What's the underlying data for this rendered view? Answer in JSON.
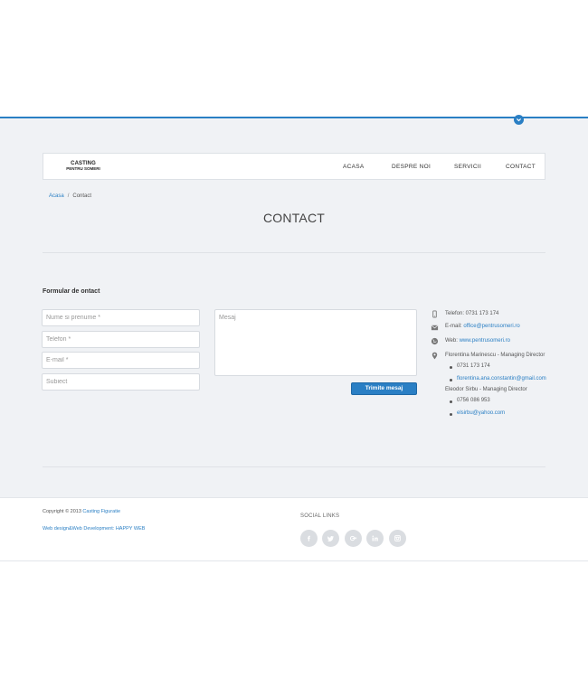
{
  "header": {
    "logo_line1": "CASTING",
    "logo_line2": "PENTRU SOMERI",
    "nav": [
      {
        "label": "ACASA"
      },
      {
        "label": "DESPRE NOI"
      },
      {
        "label": "SERVICII"
      },
      {
        "label": "CONTACT"
      }
    ]
  },
  "breadcrumb": {
    "home": "Acasa",
    "separator": "/",
    "current": "Contact"
  },
  "page_title": "CONTACT",
  "form": {
    "heading": "Formular de ontact",
    "name_placeholder": "Nume si prenume *",
    "phone_placeholder": "Telefon *",
    "email_placeholder": "E-mail *",
    "subject_placeholder": "Subiect",
    "message_placeholder": "Mesaj",
    "submit_label": "Trimite mesaj"
  },
  "contact_info": {
    "phone": "Telefon: 0731 173 174",
    "email_label": "E-mail: ",
    "email": "office@pentrusomeri.ro",
    "web_label": "Web: ",
    "web": "www.pentrusomeri.ro",
    "person1": "Florentina Marinescu - Managing Director",
    "person1_phone": "0731 173 174",
    "person1_email": "florentina.ana.constantin@gmail.com",
    "person2": "Eleodor Sirbu - Managing Director",
    "person2_phone": "0756 086 953",
    "person2_email": "elsirbu@yahoo.com"
  },
  "footer": {
    "copyright_prefix": "Copyright © 2013 ",
    "copyright_link": "Casting Figuratie",
    "credit_link": "Web design&Web Development: HAPPY WEB",
    "social_title": "SOCIAL LINKS",
    "social_icons": [
      "facebook-icon",
      "twitter-icon",
      "google-plus-icon",
      "linkedin-icon",
      "instagram-icon"
    ]
  },
  "colors": {
    "accent": "#2a7fc4",
    "page_background": "#f0f2f5",
    "social_circle": "#dadde1"
  }
}
